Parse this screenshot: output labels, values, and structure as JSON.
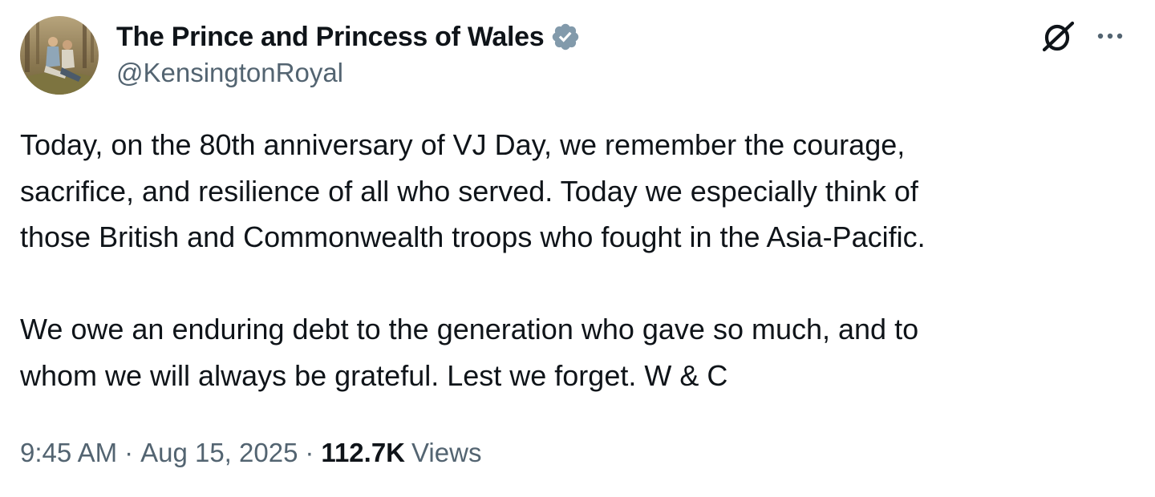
{
  "author": {
    "display_name": "The Prince and Princess of Wales",
    "handle": "@KensingtonRoyal",
    "verified_badge_color": "#829aab",
    "avatar": "avatar-photo"
  },
  "icons": {
    "grok": "grok-icon",
    "more": "more-icon",
    "verified": "verified-badge-icon"
  },
  "tweet": {
    "paragraph_1": [
      "Today, on the 80th anniversary of VJ Day, we remember the courage,",
      "sacrifice, and resilience of all who served. Today we especially think of",
      "those British and Commonwealth troops who fought in the Asia-Pacific."
    ],
    "paragraph_2": [
      "We owe an enduring debt to the generation who gave so much, and to",
      "whom we will always be grateful. Lest we forget. W & C"
    ]
  },
  "meta": {
    "time": "9:45 AM",
    "separator": "·",
    "date": "Aug 15, 2025",
    "views_count": "112.7K",
    "views_label": "Views"
  },
  "colors": {
    "text_primary": "#0f1419",
    "text_secondary": "#536471",
    "background": "#ffffff"
  }
}
